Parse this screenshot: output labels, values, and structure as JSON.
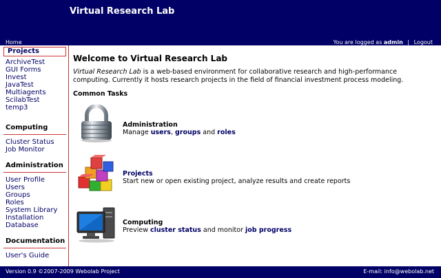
{
  "header": {
    "title": "Virtual Research Lab",
    "home_link": "Home",
    "logged_as_prefix": "You are logged as",
    "username": "admin",
    "separator": "|",
    "logout_link": "Logout"
  },
  "sidebar": {
    "projects_heading": "Projects",
    "projects": [
      "ArchiveTest",
      "GUI Forms",
      "Invest",
      "JavaTest",
      "Multiagents",
      "ScilabTest",
      "temp3"
    ],
    "computing_heading": "Computing",
    "computing": [
      "Cluster Status",
      "Job Monitor"
    ],
    "administration_heading": "Administration",
    "administration": [
      "User Profile",
      "Users",
      "Groups",
      "Roles",
      "System Library",
      "Installation",
      "Database"
    ],
    "documentation_heading": "Documentation",
    "documentation": [
      "User's Guide"
    ]
  },
  "main": {
    "welcome": "Welcome to Virtual Research Lab",
    "intro_italic": "Virtual Research Lab",
    "intro_rest": " is a web-based environment for collaborative research and high-performance computing. Currently it hosts research projects in the field of financial investment process modeling.",
    "common_tasks": "Common Tasks",
    "tasks": {
      "admin": {
        "title": "Administration",
        "pre": "Manage ",
        "link1": "users",
        "mid1": ", ",
        "link2": "groups",
        "mid2": " and ",
        "link3": "roles"
      },
      "projects": {
        "title": "Projects",
        "desc": "Start new or open existing project, analyze results and create reports"
      },
      "computing": {
        "title": "Computing",
        "pre": "Preview ",
        "link1": "cluster status",
        "mid1": " and monitor ",
        "link2": "job progress"
      }
    }
  },
  "footer": {
    "version": "Version 0.9   ©2007-2009 Webolab Project",
    "email": "E-mail: info@webolab.net"
  },
  "icons": {
    "admin": "padlock-icon",
    "projects": "blocks-icon",
    "computing": "computer-icon"
  },
  "colors": {
    "header_bg": "#000066",
    "link": "#000066",
    "accent_rule": "#cc3333"
  }
}
